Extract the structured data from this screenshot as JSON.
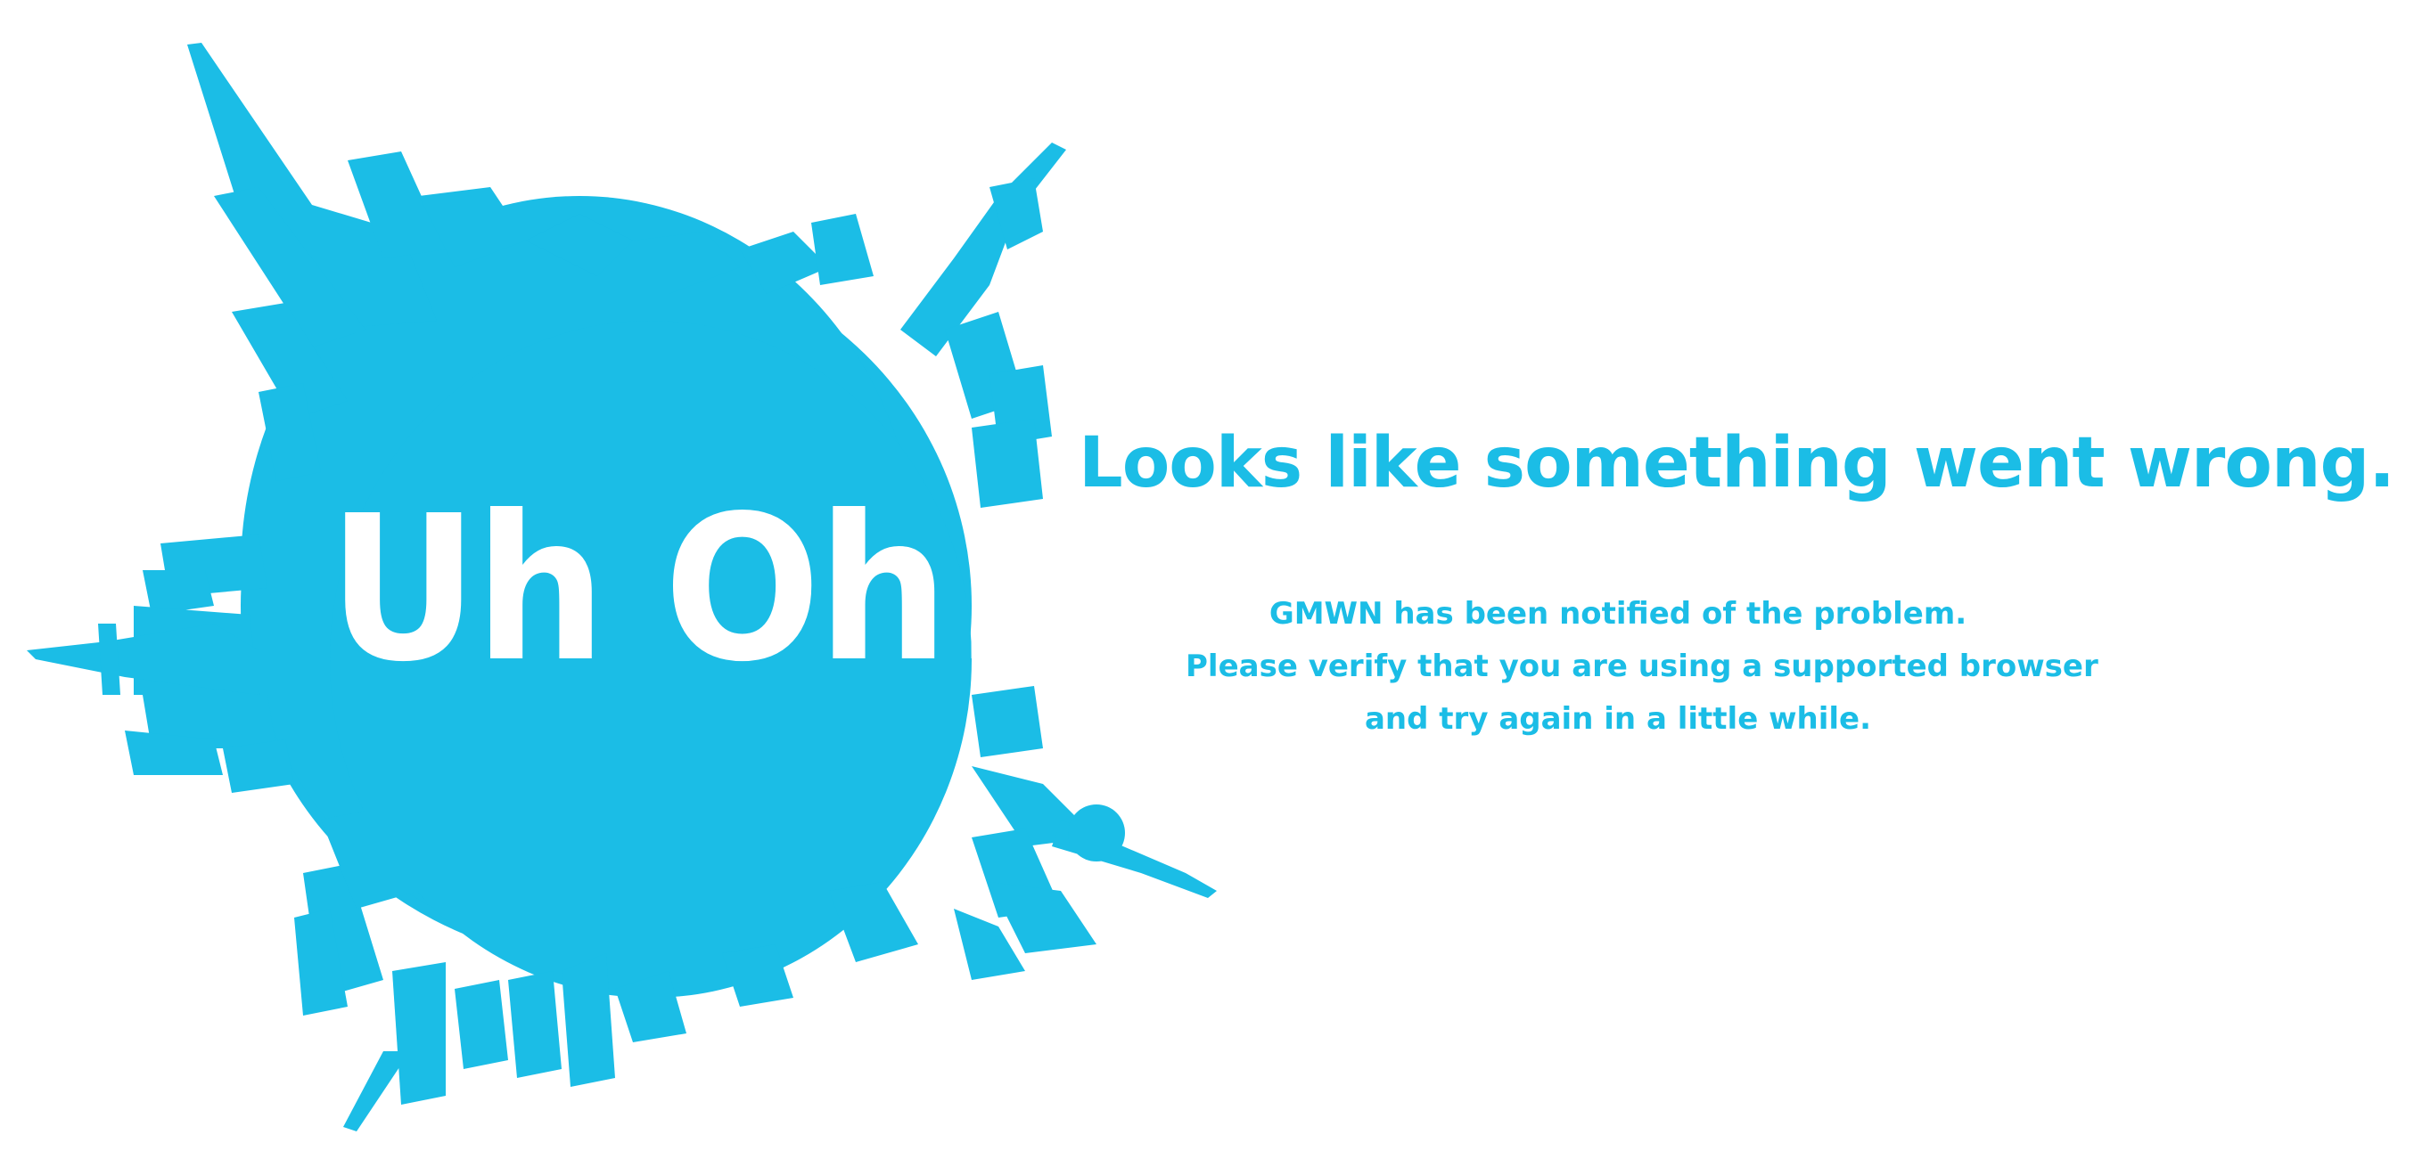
{
  "splash": {
    "title": "Uh Oh!",
    "color": "#1bbde6",
    "text_color": "#ffffff"
  },
  "error": {
    "headline": "Looks like something went wrong.",
    "lines": [
      "GMWN has been notified of the problem.",
      "Please verify that you are using a supported browser",
      "and try again in a little while."
    ]
  }
}
